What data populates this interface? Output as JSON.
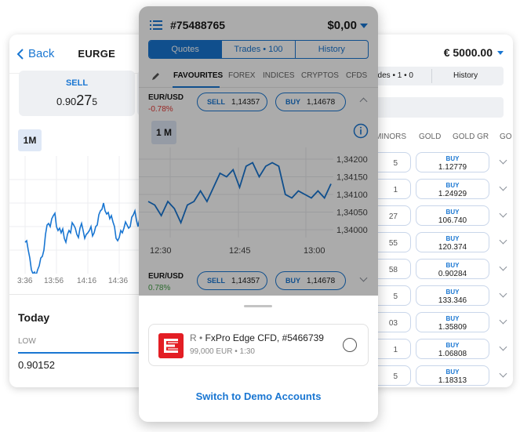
{
  "left": {
    "back_label": "Back",
    "title": "EURGE",
    "sell_label": "SELL",
    "sell_price_pre": "0.90",
    "sell_price_big": "27",
    "sell_price_post": "5",
    "timeframe": "1M",
    "times": [
      "3:36",
      "13:56",
      "14:16",
      "14:36"
    ],
    "today_label": "Today",
    "low_label": "LOW",
    "low_value": "0.90152"
  },
  "right": {
    "balance": "€ 5000.00",
    "tab_trades": "ades • 1 • 0",
    "tab_history": "History",
    "categories": [
      "MINORS",
      "GOLD",
      "GOLD GR",
      "GO"
    ],
    "rows": [
      {
        "sell_stub": "5",
        "buy_label": "BUY",
        "buy": "1.12779"
      },
      {
        "sell_stub": "1",
        "buy_label": "BUY",
        "buy": "1.24929"
      },
      {
        "sell_stub": "27",
        "buy_label": "BUY",
        "buy": "106.740"
      },
      {
        "sell_stub": "55",
        "buy_label": "BUY",
        "buy": "120.374"
      },
      {
        "sell_stub": "58",
        "buy_label": "BUY",
        "buy": "0.90284"
      },
      {
        "sell_stub": "5",
        "buy_label": "BUY",
        "buy": "133.346"
      },
      {
        "sell_stub": "03",
        "buy_label": "BUY",
        "buy": "1.35809"
      },
      {
        "sell_stub": "1",
        "buy_label": "BUY",
        "buy": "1.06808"
      },
      {
        "sell_stub": "5",
        "buy_label": "BUY",
        "buy": "1.18313"
      }
    ]
  },
  "phone": {
    "account_id": "#75488765",
    "balance": "$0,00",
    "segments": [
      "Quotes",
      "Trades • 100",
      "History"
    ],
    "active_segment": "Quotes",
    "categories": [
      "FAVOURITES",
      "FOREX",
      "INDICES",
      "CRYPTOS",
      "CFDS"
    ],
    "quotes": [
      {
        "symbol": "EUR/USD",
        "change": "-0.78%",
        "change_color": "#e53935",
        "sell_label": "SELL",
        "sell": "1,14357",
        "buy_label": "BUY",
        "buy": "1,14678"
      },
      {
        "symbol": "EUR/USD",
        "change": "0.78%",
        "change_color": "#43a047",
        "sell_label": "SELL",
        "sell": "1,14357",
        "buy_label": "BUY",
        "buy": "1,14678"
      }
    ],
    "timeframe": "1 M",
    "y_ticks": [
      "1,34200",
      "1,34150",
      "1,34100",
      "1,34050",
      "1,34000"
    ],
    "x_ticks": [
      "12:30",
      "12:45",
      "13:00"
    ],
    "sheet": {
      "account_prefix": "R •",
      "account_name": "FxPro Edge CFD, #5466739",
      "account_sub": "99,000 EUR • 1:30",
      "switch_label": "Switch to Demo Accounts"
    }
  },
  "chart_data": {
    "type": "line",
    "x": [
      "12:30",
      "12:45",
      "13:00"
    ],
    "y_ticks": [
      1.342,
      1.3415,
      1.341,
      1.3405,
      1.34
    ],
    "ylim": [
      1.34,
      1.342
    ],
    "series": [
      {
        "values": [
          1.3408,
          1.3407,
          1.3404,
          1.3408,
          1.3406,
          1.3402,
          1.3407,
          1.3408,
          1.3411,
          1.3408,
          1.3412,
          1.3416,
          1.3415,
          1.3417,
          1.3412,
          1.3418,
          1.3419,
          1.3415,
          1.3418,
          1.3419,
          1.3418,
          1.341,
          1.3409,
          1.3411,
          1.341,
          1.3409,
          1.3411,
          1.3409,
          1.3413
        ]
      }
    ]
  },
  "colors": {
    "accent": "#1976d2",
    "negative": "#e53935",
    "positive": "#43a047"
  }
}
